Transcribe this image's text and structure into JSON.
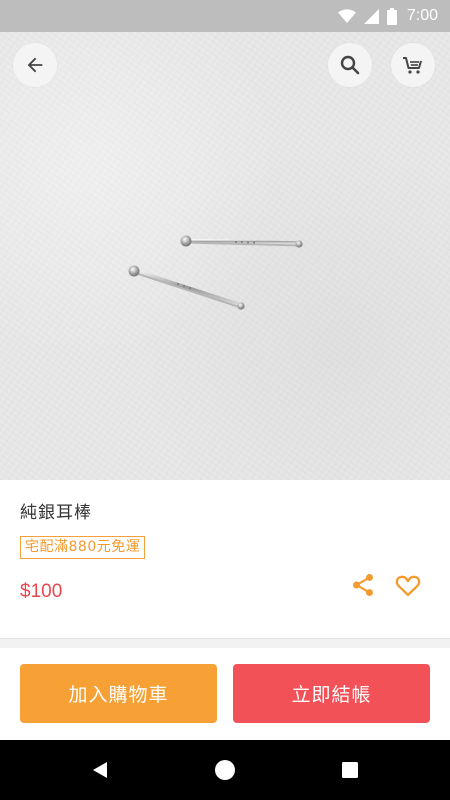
{
  "status_bar": {
    "time": "7:00",
    "icons": [
      "wifi-icon",
      "signal-icon",
      "battery-icon"
    ]
  },
  "header": {
    "back_icon": "arrow-left-icon",
    "search_icon": "search-icon",
    "cart_icon": "shopping-cart-icon"
  },
  "product": {
    "image_alt": "sterling silver stud earrings",
    "title": "純銀耳棒",
    "shipping_badge": "宅配滿880元免運",
    "price": "$100",
    "share_icon": "share-icon",
    "favorite_icon": "heart-icon"
  },
  "actions": {
    "add_to_cart_label": "加入購物車",
    "checkout_label": "立即結帳"
  },
  "nav_bar": {
    "icons": [
      "back-triangle-icon",
      "home-circle-icon",
      "recents-square-icon"
    ]
  },
  "colors": {
    "status_bar_bg": "#bdbdbd",
    "accent_orange": "#f7a035",
    "accent_red": "#f25158",
    "price_red": "#e8474f"
  }
}
